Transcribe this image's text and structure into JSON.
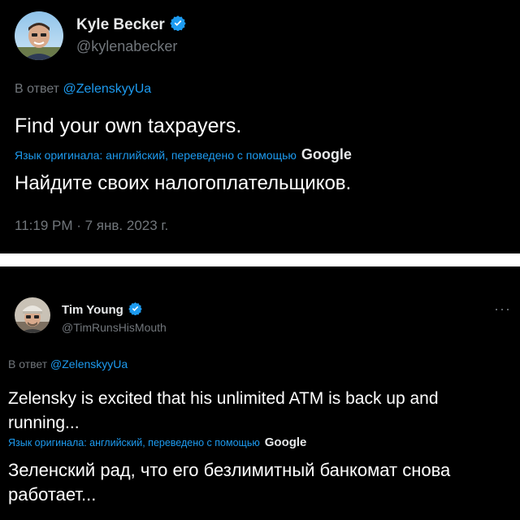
{
  "tweets": [
    {
      "name": "Kyle Becker",
      "handle": "@kylenabecker",
      "reply_prefix": "В ответ",
      "reply_to": "@ZelenskyyUa",
      "text": "Find your own taxpayers.",
      "translation_note": "Язык оригинала: английский, переведено с помощью",
      "translator": "Google",
      "translation": "Найдите своих налогоплательщиков.",
      "timestamp": "11:19 PM · 7 янв. 2023 г.",
      "icons": {
        "verified": "verified-badge-icon",
        "avatar": "avatar-photo"
      }
    },
    {
      "name": "Tim Young",
      "handle": "@TimRunsHisMouth",
      "reply_prefix": "В ответ",
      "reply_to": "@ZelenskyyUa",
      "text": "Zelensky is excited that his unlimited ATM is back up and running...",
      "translation_note": "Язык оригинала: английский, переведено с помощью",
      "translator": "Google",
      "translation": "Зеленский рад, что его безлимитный банкомат снова работает...",
      "more": "···",
      "icons": {
        "verified": "verified-badge-icon",
        "avatar": "avatar-photo",
        "more": "more-options-icon"
      }
    }
  ],
  "colors": {
    "background": "#000000",
    "text": "#e7e9ea",
    "secondary": "#71767b",
    "accent": "#1d9bf0",
    "divider": "#ffffff"
  }
}
